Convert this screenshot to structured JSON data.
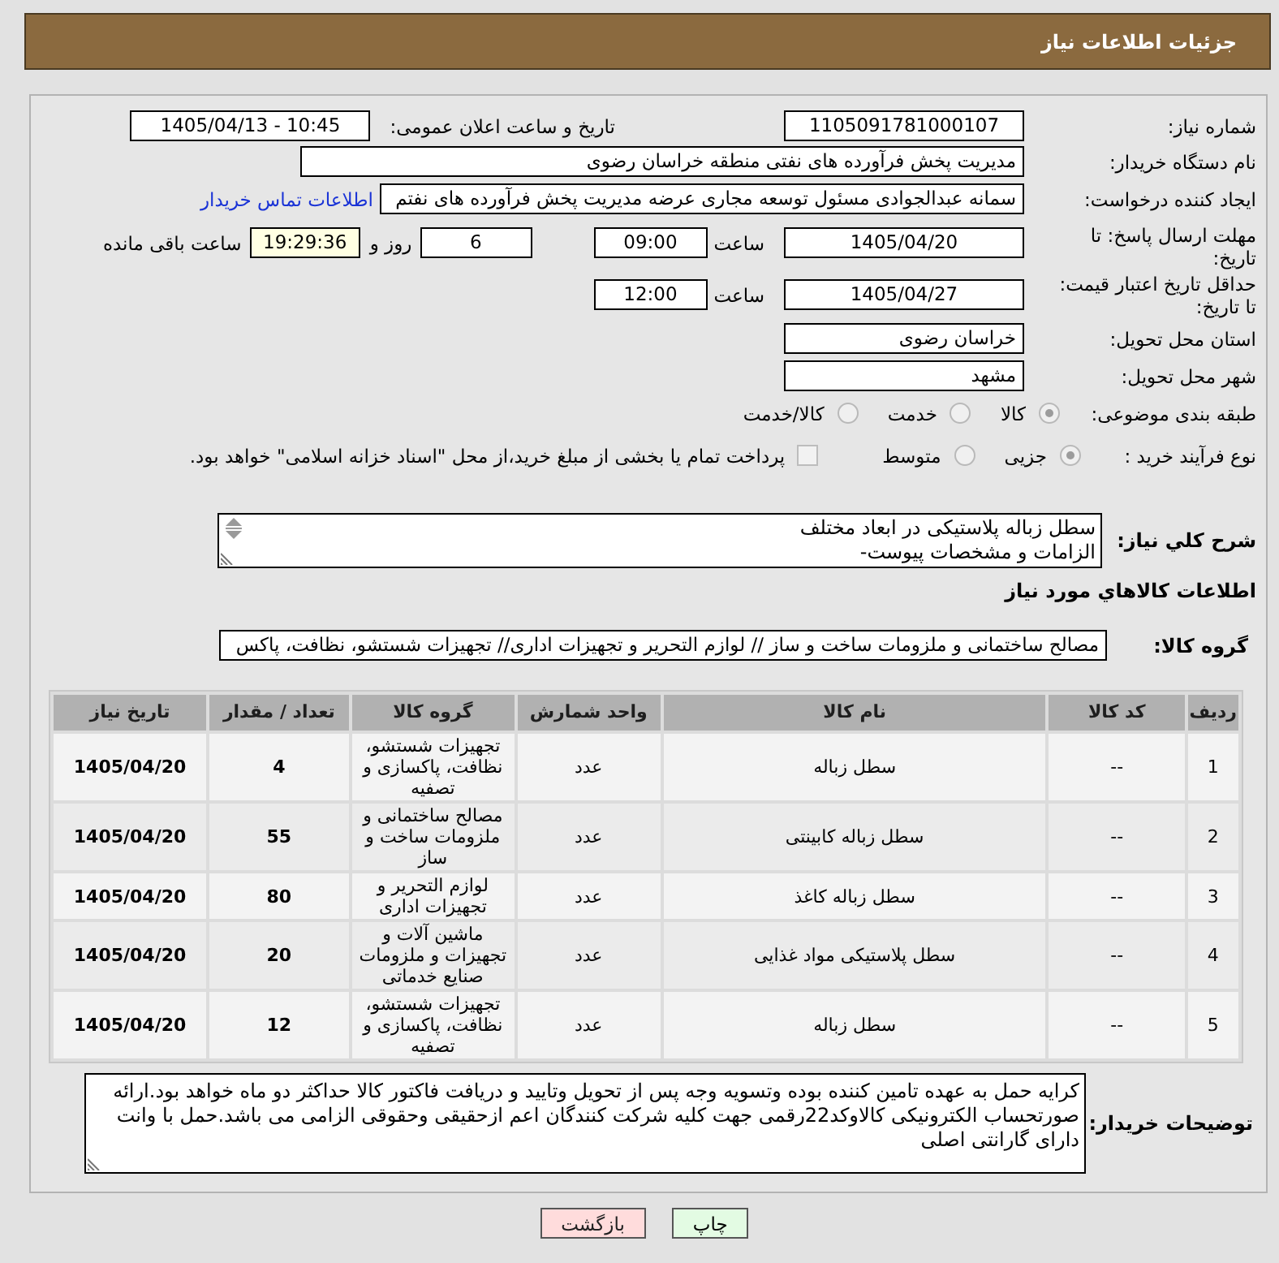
{
  "header": {
    "title": "جزئیات اطلاعات نیاز"
  },
  "need_number": {
    "label": "شماره نیاز:",
    "value": "1105091781000107"
  },
  "announcement": {
    "label": "تاریخ و ساعت اعلان عمومی:",
    "value": "1405/04/13 - 10:45"
  },
  "buyer_organization": {
    "label": "نام دستگاه خریدار:",
    "value": "مدیریت پخش فرآورده های نفتی منطقه خراسان رضوی"
  },
  "requester": {
    "label": "ایجاد کننده درخواست:",
    "value": "سمانه عبدالجوادی مسئول توسعه مجاری عرضه مدیریت پخش فرآورده های نفتم",
    "contact_link": "اطلاعات تماس خریدار"
  },
  "response_deadline": {
    "label": "مهلت ارسال پاسخ: تا تاریخ:",
    "date": "1405/04/20",
    "time_label": "ساعت",
    "time": "09:00",
    "days": "6",
    "days_label": "روز و",
    "remaining": "19:29:36",
    "remaining_label": "ساعت باقی مانده"
  },
  "price_validity": {
    "label": "حداقل تاریخ اعتبار قیمت: تا تاریخ:",
    "date": "1405/04/27",
    "time_label": "ساعت",
    "time": "12:00"
  },
  "delivery_province": {
    "label": "استان محل تحویل:",
    "value": "خراسان رضوی"
  },
  "delivery_city": {
    "label": "شهر محل تحویل:",
    "value": "مشهد"
  },
  "subject_category": {
    "label": "طبقه بندی موضوعی:",
    "options": [
      {
        "label": "کالا",
        "selected": true,
        "disabled": true
      },
      {
        "label": "خدمت",
        "selected": false,
        "disabled": true
      },
      {
        "label": "کالا/خدمت",
        "selected": false,
        "disabled": true
      }
    ]
  },
  "purchase_process": {
    "label": "نوع فرآیند خرید :",
    "options": [
      {
        "label": "جزیی",
        "selected": true,
        "disabled": true
      },
      {
        "label": "متوسط",
        "selected": false,
        "disabled": true
      }
    ],
    "treasury_payment": {
      "label": "پرداخت تمام یا بخشی از مبلغ خرید،از محل \"اسناد خزانه اسلامی\" خواهد بود.",
      "checked": false,
      "disabled": true
    }
  },
  "general_description": {
    "label": "شرح كلي نياز:",
    "value": "سطل زباله پلاستیکی در ابعاد مختلف\nالزامات و مشخصات پیوست-"
  },
  "items_heading": "اطلاعات كالاهاي مورد نياز",
  "goods_group": {
    "label": "گروه كالا:",
    "value": "مصالح ساختمانی و ملزومات ساخت و ساز // لوازم التحریر و تجهیزات اداری// تجهیزات شستشو، نظافت، پاکس"
  },
  "table": {
    "columns": [
      "ردیف",
      "کد کالا",
      "نام کالا",
      "واحد شمارش",
      "گروه کالا",
      "تعداد / مقدار",
      "تاریخ نیاز"
    ],
    "rows": [
      [
        "1",
        "--",
        "سطل زباله",
        "عدد",
        "تجهیزات شستشو، نظافت، پاکسازی و تصفیه",
        "4",
        "1405/04/20"
      ],
      [
        "2",
        "--",
        "سطل زباله کابینتی",
        "عدد",
        "مصالح ساختمانی و ملزومات ساخت و ساز",
        "55",
        "1405/04/20"
      ],
      [
        "3",
        "--",
        "سطل زباله کاغذ",
        "عدد",
        "لوازم التحریر و تجهیزات اداری",
        "80",
        "1405/04/20"
      ],
      [
        "4",
        "--",
        "سطل پلاستیکی مواد غذایی",
        "عدد",
        "ماشین آلات و تجهیزات و ملزومات صنایع خدماتی",
        "20",
        "1405/04/20"
      ],
      [
        "5",
        "--",
        "سطل زباله",
        "عدد",
        "تجهیزات شستشو، نظافت، پاکسازی و تصفیه",
        "12",
        "1405/04/20"
      ]
    ]
  },
  "buyer_notes": {
    "label": "توضیحات خریدار:",
    "value": "کرایه حمل به عهده تامین کننده بوده وتسویه وجه پس از تحویل وتایید و دریافت فاکتور کالا حداکثر دو ماه خواهد بود.ارائه صورتحساب الکترونیکی کالاوکد22رقمی جهت کلیه شرکت کنندگان اعم ازحقیقی وحقوقی الزامی می باشد.حمل با وانت دارای گارانتی اصلی"
  },
  "buttons": [
    {
      "label": "چاپ",
      "kind": "print"
    },
    {
      "label": "بازگشت",
      "kind": "back"
    }
  ]
}
